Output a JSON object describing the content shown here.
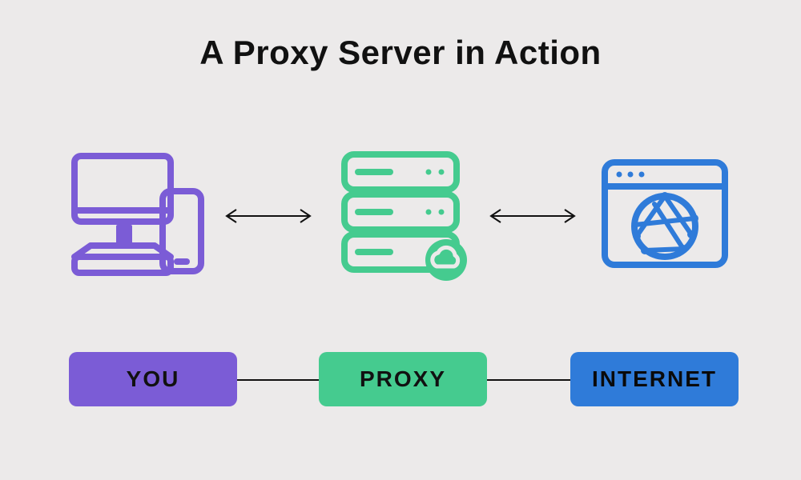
{
  "title": "A Proxy Server in Action",
  "nodes": {
    "you": {
      "label": "YOU",
      "color": "#7b5cd6",
      "icon": "desktop-and-phone"
    },
    "proxy": {
      "label": "PROXY",
      "color": "#45cb8f",
      "icon": "server"
    },
    "internet": {
      "label": "INTERNET",
      "color": "#2f7bd9",
      "icon": "browser-globe"
    }
  },
  "flow": [
    {
      "from": "you",
      "to": "proxy",
      "bidirectional": true
    },
    {
      "from": "proxy",
      "to": "internet",
      "bidirectional": true
    }
  ]
}
